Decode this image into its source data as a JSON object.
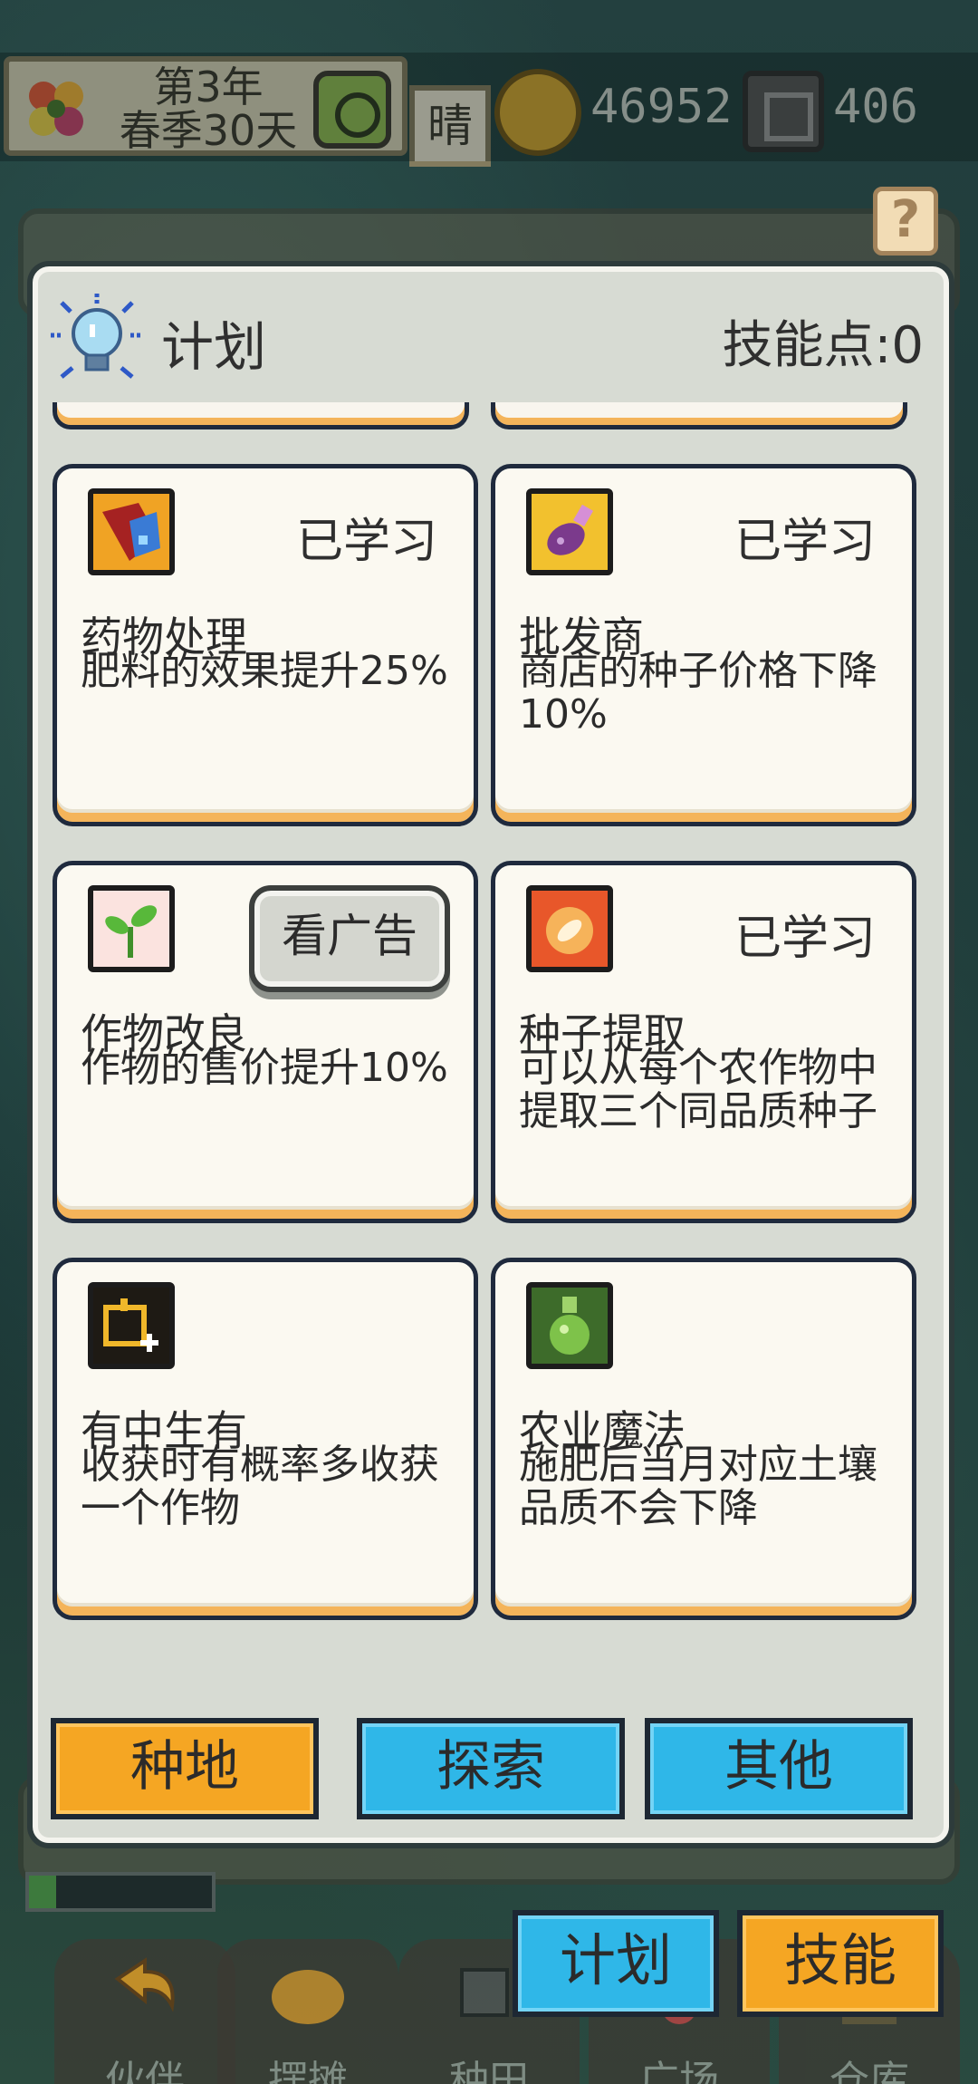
{
  "hud": {
    "date_line1": "第3年",
    "date_line2": "春季30天",
    "weather": "晴",
    "coins": "46952",
    "gems": "406",
    "icons": {
      "flower": "flower-icon",
      "clock": "clock-icon",
      "coin": "coin-icon",
      "gem": "gem-icon"
    }
  },
  "help_label": "?",
  "panel": {
    "title": "计划",
    "skill_points": "技能点:0",
    "cards": [
      {
        "name": "药物处理",
        "desc": "肥料的效果提升25%",
        "status": "已学习",
        "icon": "potion-flask-icon"
      },
      {
        "name": "批发商",
        "desc": "商店的种子价格下降10%",
        "status": "已学习",
        "icon": "seed-bag-icon"
      },
      {
        "name": "作物改良",
        "desc": "作物的售价提升10%",
        "status": "看广告",
        "icon": "sprout-icon"
      },
      {
        "name": "种子提取",
        "desc": "可以从每个农作物中提取三个同品质种子",
        "status": "已学习",
        "icon": "extract-icon"
      },
      {
        "name": "有中生有",
        "desc": "收获时有概率多收获一个作物",
        "status": "",
        "icon": "sparkle-plus-icon"
      },
      {
        "name": "农业魔法",
        "desc": "施肥后当月对应土壤品质不会下降",
        "status": "",
        "icon": "magic-potion-icon"
      }
    ],
    "tabs": [
      "种地",
      "探索",
      "其他"
    ]
  },
  "bottom": {
    "progress": 0.15,
    "nav": [
      "伙伴",
      "摆摊",
      "种田",
      "广场",
      "仓库"
    ],
    "plan_button": "计划",
    "skill_button": "技能"
  },
  "colors": {
    "accent_orange": "#f5a623",
    "accent_blue": "#2fb7e8",
    "card_bg": "#fbf9f1",
    "panel_bg": "#d7dbd3",
    "outline": "#1f2a3d"
  }
}
